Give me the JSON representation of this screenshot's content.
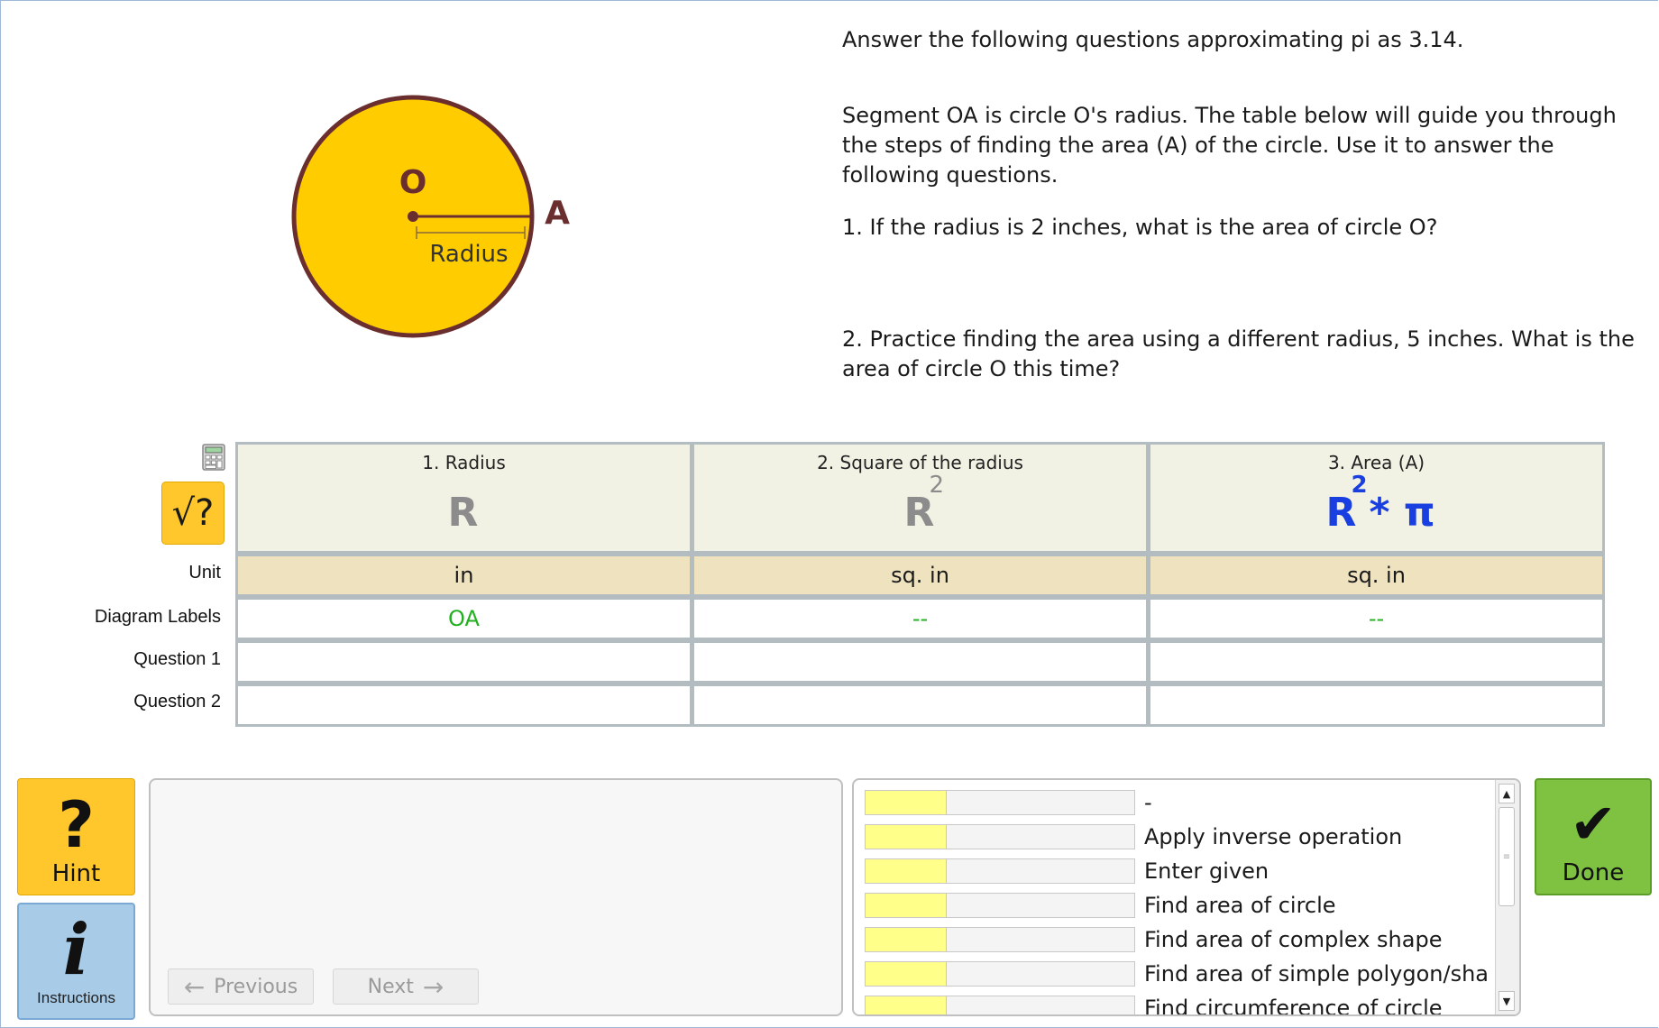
{
  "diagram": {
    "center_label": "O",
    "point_label": "A",
    "radius_label": "Radius"
  },
  "questions": {
    "intro": "Answer the following questions approximating pi as 3.14.",
    "description": "Segment OA is circle O's radius. The table below will guide you through the steps of finding the area (A) of the circle. Use it to answer the following questions.",
    "q1": "1. If the radius is 2 inches, what is the area of circle O?",
    "q2": "2. Practice finding the area using a different radius, 5 inches. What is the area of circle O this time?"
  },
  "table": {
    "row_labels": {
      "unit": "Unit",
      "diagram_labels": "Diagram Labels",
      "question1": "Question 1",
      "question2": "Question 2"
    },
    "columns": [
      {
        "title": "1. Radius",
        "formula_base": "R",
        "formula_exp": "",
        "formula_rest": "",
        "unit": "in",
        "diagram_label": "OA"
      },
      {
        "title": "2. Square of the radius",
        "formula_base": "R",
        "formula_exp": "2",
        "formula_rest": "",
        "unit": "sq. in",
        "diagram_label": "--"
      },
      {
        "title": "3. Area (A)",
        "formula_base": "R",
        "formula_exp": "2",
        "formula_rest": "* π",
        "unit": "sq. in",
        "diagram_label": "--"
      }
    ],
    "question1_values": [
      "",
      "",
      ""
    ],
    "question2_values": [
      "",
      "",
      ""
    ]
  },
  "tools": {
    "sqrt_label": "√?",
    "calculator_icon": "calculator-icon"
  },
  "buttons": {
    "hint": "Hint",
    "hint_icon": "?",
    "instructions": "Instructions",
    "instructions_icon": "i",
    "done": "Done",
    "done_icon": "✔",
    "previous": "Previous",
    "next": "Next"
  },
  "skills": [
    {
      "name": "-",
      "mastery": 0.3
    },
    {
      "name": "Apply inverse operation",
      "mastery": 0.3
    },
    {
      "name": "Enter given",
      "mastery": 0.3
    },
    {
      "name": "Find area of circle",
      "mastery": 0.3
    },
    {
      "name": "Find area of complex shape",
      "mastery": 0.3
    },
    {
      "name": "Find area of simple polygon/sha",
      "mastery": 0.3
    },
    {
      "name": "Find circumference of circle",
      "mastery": 0.3
    }
  ],
  "colors": {
    "circle_fill": "#ffcc00",
    "circle_stroke": "#6b2e2e",
    "formula_gray": "#8c8c8c",
    "formula_blue": "#1a3fe0",
    "label_green": "#22b022",
    "hint_yellow": "#ffc72c",
    "instructions_blue": "#a8cbe8",
    "done_green": "#7fc241"
  }
}
